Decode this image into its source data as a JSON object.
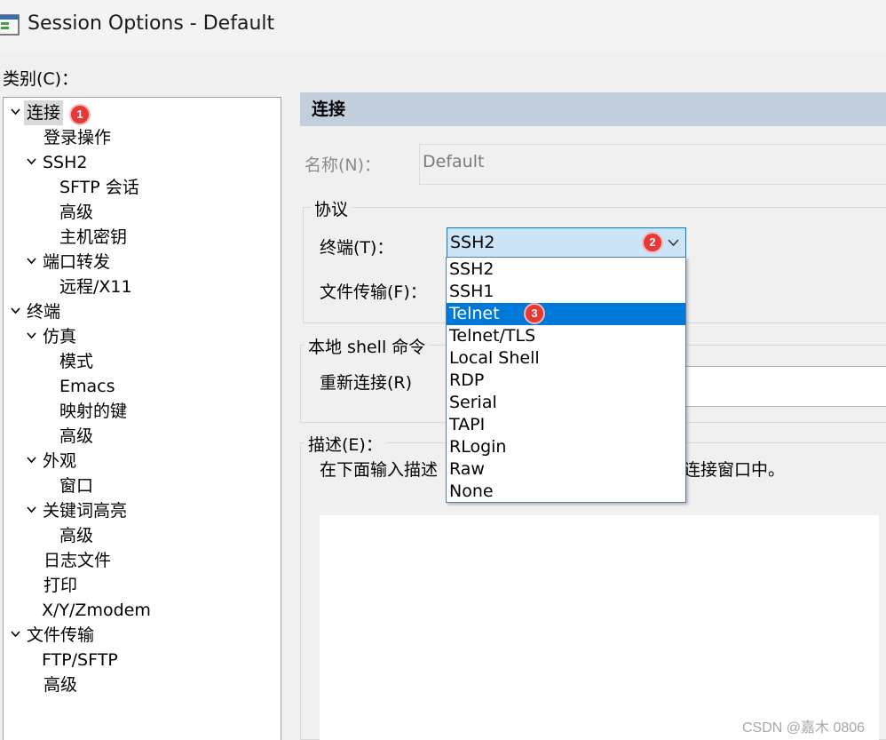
{
  "window": {
    "title": "Session Options - Default"
  },
  "category_label": "类别(C)：",
  "tree": {
    "items": [
      {
        "label": "连接"
      },
      {
        "label": "登录操作"
      },
      {
        "label": "SSH2"
      },
      {
        "label": "SFTP 会话"
      },
      {
        "label": "高级"
      },
      {
        "label": "主机密钥"
      },
      {
        "label": "端口转发"
      },
      {
        "label": "远程/X11"
      },
      {
        "label": "终端"
      },
      {
        "label": "仿真"
      },
      {
        "label": "模式"
      },
      {
        "label": "Emacs"
      },
      {
        "label": "映射的键"
      },
      {
        "label": "高级"
      },
      {
        "label": "外观"
      },
      {
        "label": "窗口"
      },
      {
        "label": "关键词高亮"
      },
      {
        "label": "高级"
      },
      {
        "label": "日志文件"
      },
      {
        "label": "打印"
      },
      {
        "label": "X/Y/Zmodem"
      },
      {
        "label": "文件传输"
      },
      {
        "label": "FTP/SFTP"
      },
      {
        "label": "高级"
      }
    ]
  },
  "panel": {
    "header": "连接",
    "name_label": "名称(N)：",
    "name_value": "Default",
    "protocol_group": "协议",
    "terminal_label": "终端(T)：",
    "terminal_selected": "SSH2",
    "file_transfer_label": "文件传输(F)：",
    "local_shell_group": "本地 shell 命令",
    "reconnect_label": "重新连接(R)",
    "description_group": "描述(E)：",
    "description_hint_start": "在下面输入描述",
    "description_hint_end": "连接窗口中。"
  },
  "dropdown": {
    "options": [
      "SSH2",
      "SSH1",
      "Telnet",
      "Telnet/TLS",
      "Local Shell",
      "RDP",
      "Serial",
      "TAPI",
      "RLogin",
      "Raw",
      "None"
    ],
    "highlighted": "Telnet"
  },
  "badges": [
    "1",
    "2",
    "3"
  ],
  "watermark": "CSDN @嘉木 0806",
  "colors": {
    "header_bg": "#c3cfdc",
    "selection": "#0078d7",
    "combo_bg": "#cce4f7",
    "badge": "#e53935"
  }
}
